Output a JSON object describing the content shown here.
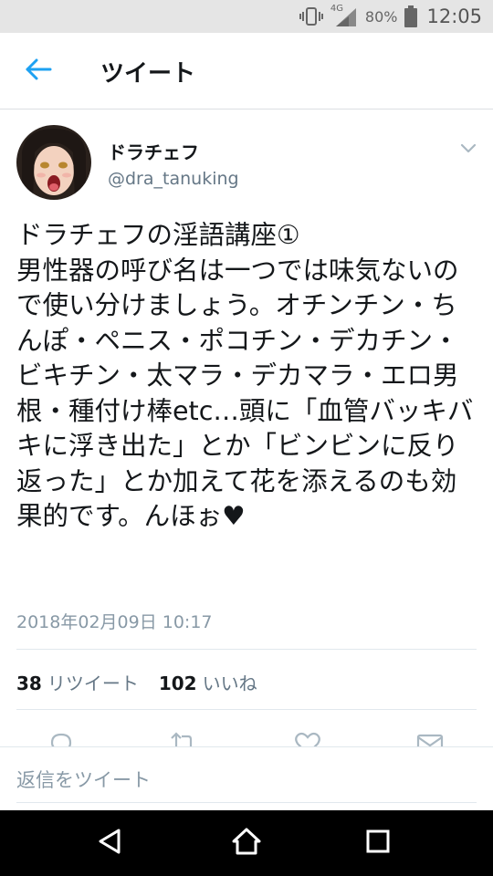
{
  "status_bar": {
    "network": "4G",
    "battery": "80%",
    "time": "12:05",
    "icons": [
      "vibrate-icon",
      "signal-icon",
      "battery-icon"
    ]
  },
  "header": {
    "back_icon": "arrow-left-icon",
    "title": "ツイート"
  },
  "tweet": {
    "display_name": "ドラチェフ",
    "handle": "@dra_tanuking",
    "text": "ドラチェフの淫語講座①\n男性器の呼び名は一つでは味気ないので使い分けましょう。オチンチン・ちんぽ・ペニス・ポコチン・デカチン・ビキチン・太マラ・デカマラ・エロ男根・種付け棒etc…頭に「血管バッキバキに浮き出た」とか「ビンビンに反り返った」とか加えて花を添えるのも効果的です。んほぉ♥",
    "timestamp": "2018年02月09日 10:17",
    "retweets": "38",
    "retweets_label": "リツイート",
    "likes": "102",
    "likes_label": "いいね"
  },
  "actions": [
    "reply-icon",
    "retweet-icon",
    "like-icon",
    "share-icon"
  ],
  "reply_bar": {
    "placeholder": "返信をツイート"
  },
  "nav_bar": [
    "back-triangle-icon",
    "home-circle-icon",
    "recents-square-icon"
  ],
  "colors": {
    "accent": "#1da1f2",
    "text": "#14171a",
    "secondary": "#657786",
    "muted": "#8899a6",
    "status_bar_bg": "#e5e5e5",
    "nav_bar_bg": "#000000"
  }
}
